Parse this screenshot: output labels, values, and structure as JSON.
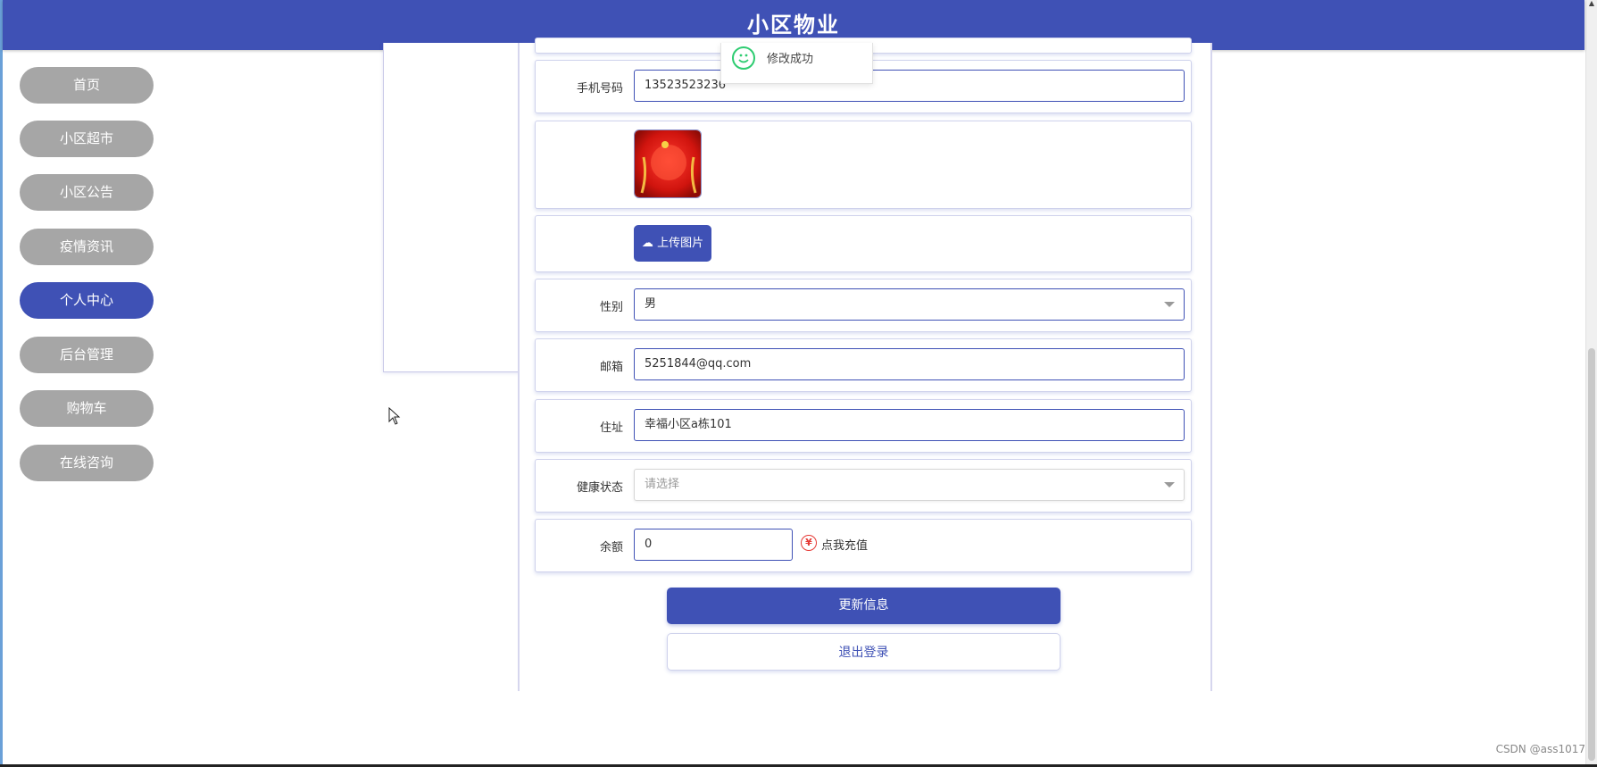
{
  "header": {
    "title": "小区物业"
  },
  "sidebar": {
    "items": [
      {
        "label": "首页"
      },
      {
        "label": "小区超市"
      },
      {
        "label": "小区公告"
      },
      {
        "label": "疫情资讯"
      },
      {
        "label": "个人中心",
        "active": true
      },
      {
        "label": "后台管理"
      },
      {
        "label": "购物车"
      },
      {
        "label": "在线咨询"
      }
    ]
  },
  "toast": {
    "message": "修改成功"
  },
  "form": {
    "phone": {
      "label": "手机号码",
      "value": "13523523236"
    },
    "upload_label": "上传图片",
    "gender": {
      "label": "性别",
      "value": "男"
    },
    "email": {
      "label": "邮箱",
      "value": "5251844@qq.com"
    },
    "address": {
      "label": "住址",
      "value": "幸福小区a栋101"
    },
    "health": {
      "label": "健康状态",
      "placeholder": "请选择"
    },
    "balance": {
      "label": "余额",
      "value": "0",
      "recharge_label": "点我充值",
      "currency_symbol": "¥"
    },
    "update_label": "更新信息",
    "logout_label": "退出登录"
  },
  "watermark": "CSDN @ass1017",
  "colors": {
    "primary": "#3f51b5",
    "nav_inactive": "#a6a6a6",
    "success": "#2ecc71",
    "danger": "#e53935"
  }
}
